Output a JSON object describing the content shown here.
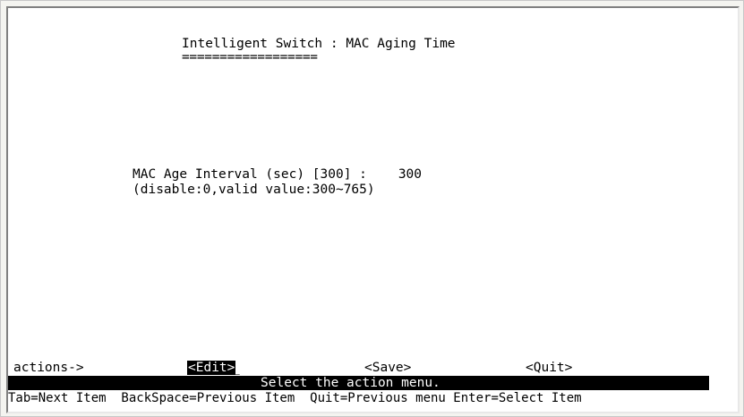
{
  "screen": {
    "title": "Intelligent Switch : MAC Aging Time",
    "title_underline": "=================="
  },
  "field": {
    "label": "MAC Age Interval (sec) [300] :",
    "value": "300",
    "hint": "(disable:0,valid value:300~765)"
  },
  "actions": {
    "label": "actions->",
    "edit": "<Edit>",
    "cursor": "_",
    "save": "<Save>",
    "quit": "<Quit>"
  },
  "status": {
    "message": "Select the action menu."
  },
  "help": {
    "line": "Tab=Next Item  BackSpace=Previous Item  Quit=Previous menu Enter=Select Item"
  }
}
